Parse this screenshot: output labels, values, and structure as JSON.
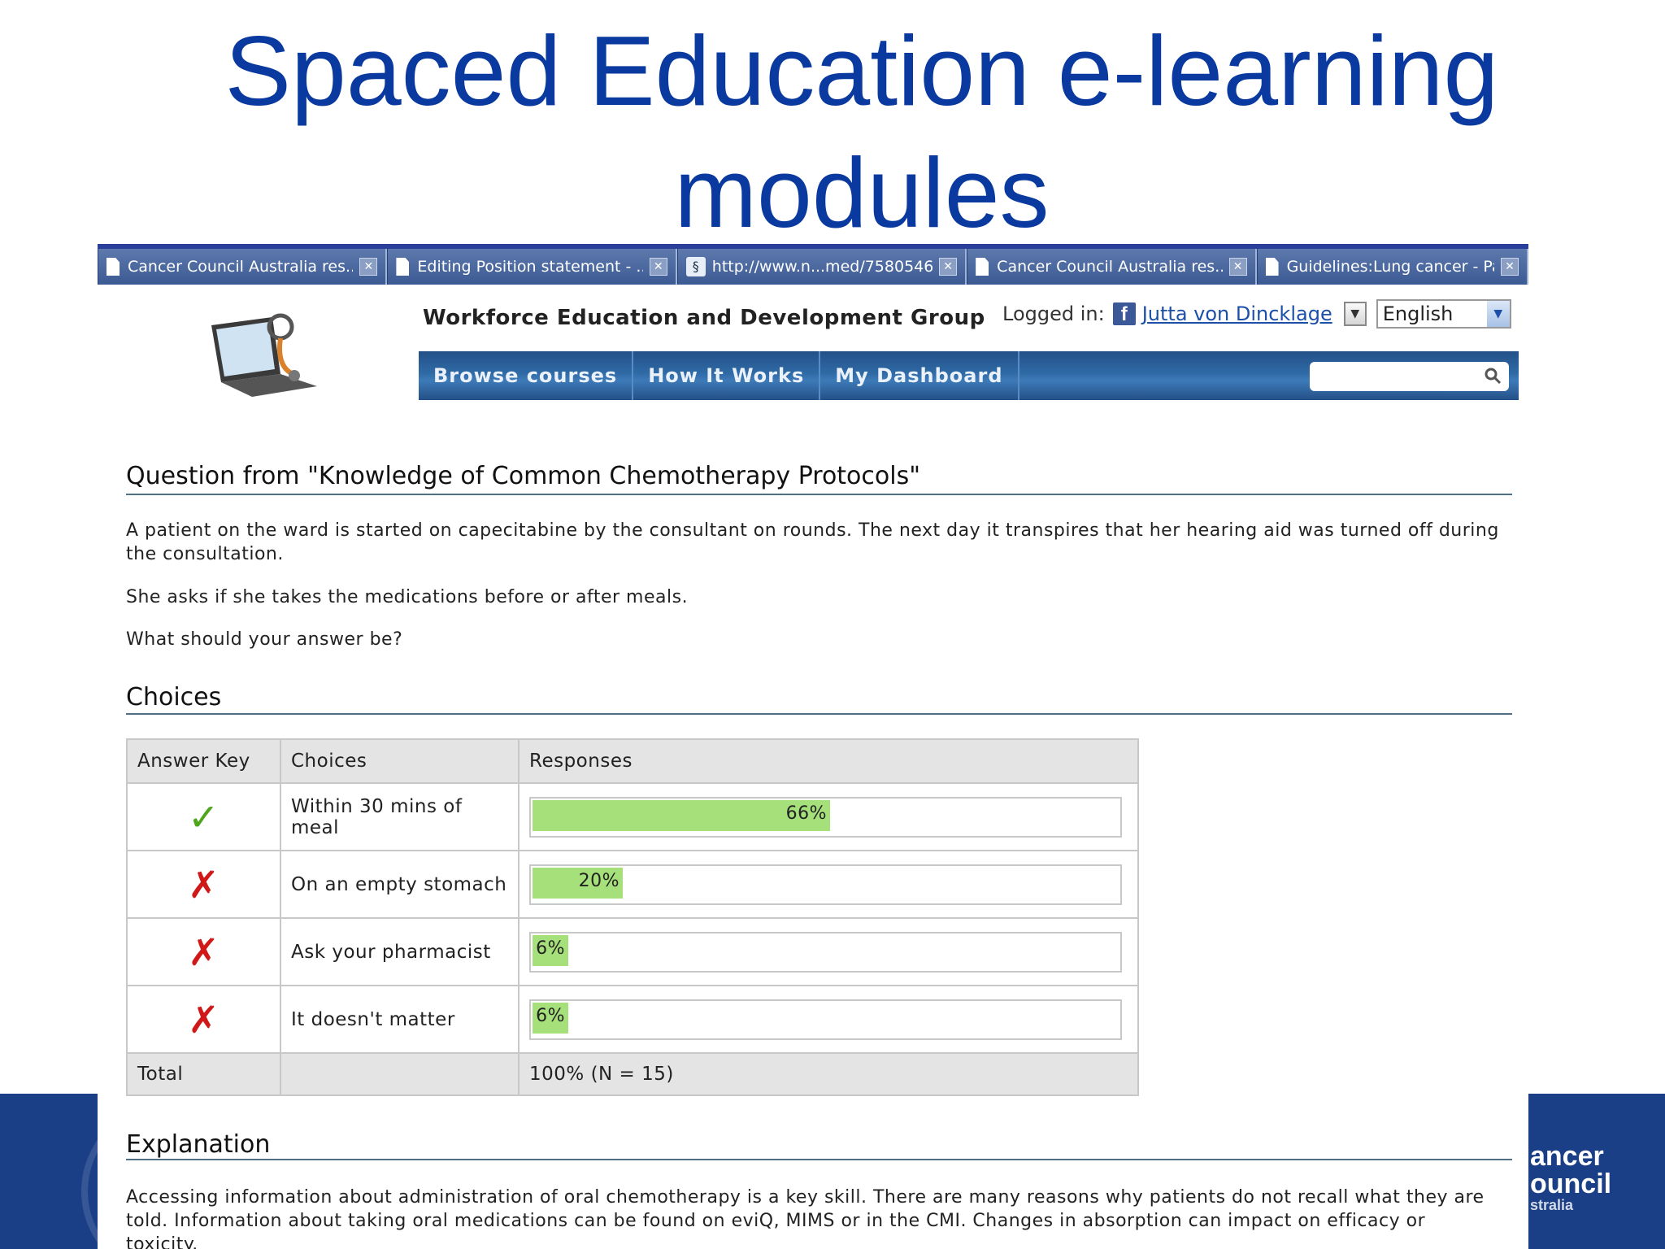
{
  "slide": {
    "title_line1": "Spaced Education e-learning",
    "title_line2": "modules",
    "brand_line1": "ancer",
    "brand_line2": "ouncil",
    "brand_line3": "stralia"
  },
  "browser": {
    "tabs": [
      {
        "label": "Cancer Council Australia res...",
        "icon": "document-icon"
      },
      {
        "label": "Editing Position statement - ...",
        "icon": "document-icon"
      },
      {
        "label": "http://www.n...med/7580546",
        "icon": "link-icon"
      },
      {
        "label": "Cancer Council Australia res...",
        "icon": "document-icon"
      },
      {
        "label": "Guidelines:Lung cancer - Pat...",
        "icon": "document-icon"
      }
    ]
  },
  "header": {
    "group_name": "Workforce Education and Development Group",
    "logged_in_label": "Logged in:",
    "user_name": "Jutta von Dincklage",
    "language": "English"
  },
  "nav": {
    "items": [
      "Browse courses",
      "How It Works",
      "My Dashboard"
    ],
    "search_placeholder": ""
  },
  "question": {
    "heading": "Question from \"Knowledge of Common Chemotherapy Protocols\"",
    "p1": "A patient on the ward is started on capecitabine by the consultant on rounds. The next day it transpires that her hearing aid was turned off during the consultation.",
    "p2": "She asks if she takes the medications before or after meals.",
    "p3": "What should your answer be?"
  },
  "choices": {
    "heading": "Choices",
    "columns": [
      "Answer Key",
      "Choices",
      "Responses"
    ],
    "rows": [
      {
        "correct": true,
        "mark": "✓",
        "choice": "Within 30 mins of meal",
        "label": "66%",
        "percent": 66
      },
      {
        "correct": false,
        "mark": "✗",
        "choice": "On an empty stomach",
        "label": "20%",
        "percent": 20
      },
      {
        "correct": false,
        "mark": "✗",
        "choice": "Ask your pharmacist",
        "label": "6%",
        "percent": 6
      },
      {
        "correct": false,
        "mark": "✗",
        "choice": "It doesn't matter",
        "label": "6%",
        "percent": 6
      }
    ],
    "total_label": "Total",
    "total_value": "100% (N = 15)"
  },
  "explanation": {
    "heading": "Explanation",
    "text": "Accessing information about administration of oral chemotherapy is a key skill. There are many reasons why patients do not recall what they are told. Information about taking oral medications can be found on eviQ, MIMS or in the CMI. Changes in absorption can impact on efficacy or toxicity."
  },
  "colors": {
    "title_blue": "#0a3aa0",
    "footer_blue": "#1b3f87",
    "bar_green": "#a6e07a",
    "correct_green": "#4ea61d",
    "wrong_red": "#d01818"
  }
}
